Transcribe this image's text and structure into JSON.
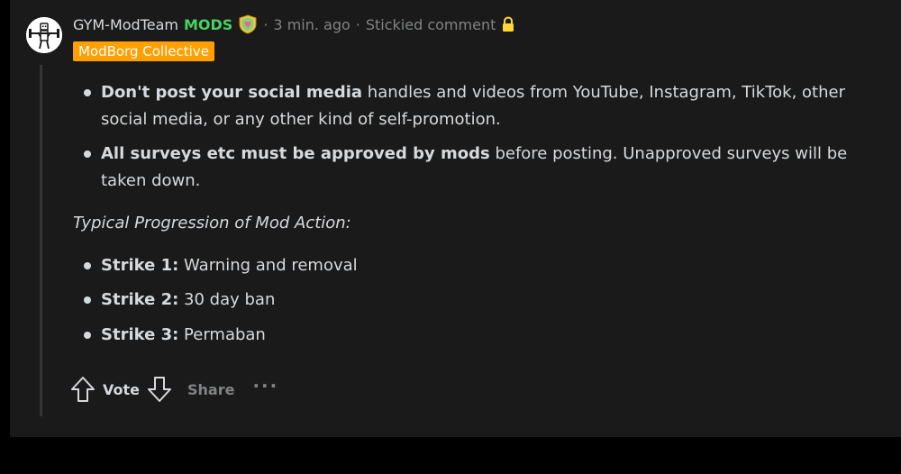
{
  "comment": {
    "author": "GYM-ModTeam",
    "mods_tag": "MODS",
    "time": "3 min. ago",
    "separator": "·",
    "stickied": "Stickied comment",
    "flair": "ModBorg Collective",
    "colors": {
      "card_bg": "#1a1a1b",
      "text": "#d7dadc",
      "muted": "#818384",
      "mods_green": "#46d160",
      "flair_bg": "#ff9f00",
      "lock": "#ffd635"
    },
    "rules": [
      {
        "bold": "Don't post your social media",
        "rest": " handles and videos from YouTube, Instagram, TikTok, other social media, or any other kind of self-promotion."
      },
      {
        "bold": "All surveys etc must be approved by mods",
        "rest": " before posting. Unapproved surveys will be taken down."
      }
    ],
    "progression_title": "Typical Progression of Mod Action:",
    "strikes": [
      {
        "bold": "Strike 1:",
        "rest": " Warning and removal"
      },
      {
        "bold": "Strike 2:",
        "rest": " 30 day ban"
      },
      {
        "bold": "Strike 3:",
        "rest": " Permaban"
      }
    ],
    "actions": {
      "vote": "Vote",
      "share": "Share",
      "more": "···"
    },
    "icons": [
      "avatar-robot-icon",
      "mod-shield-icon",
      "lock-icon",
      "upvote-icon",
      "downvote-icon",
      "more-icon"
    ]
  }
}
